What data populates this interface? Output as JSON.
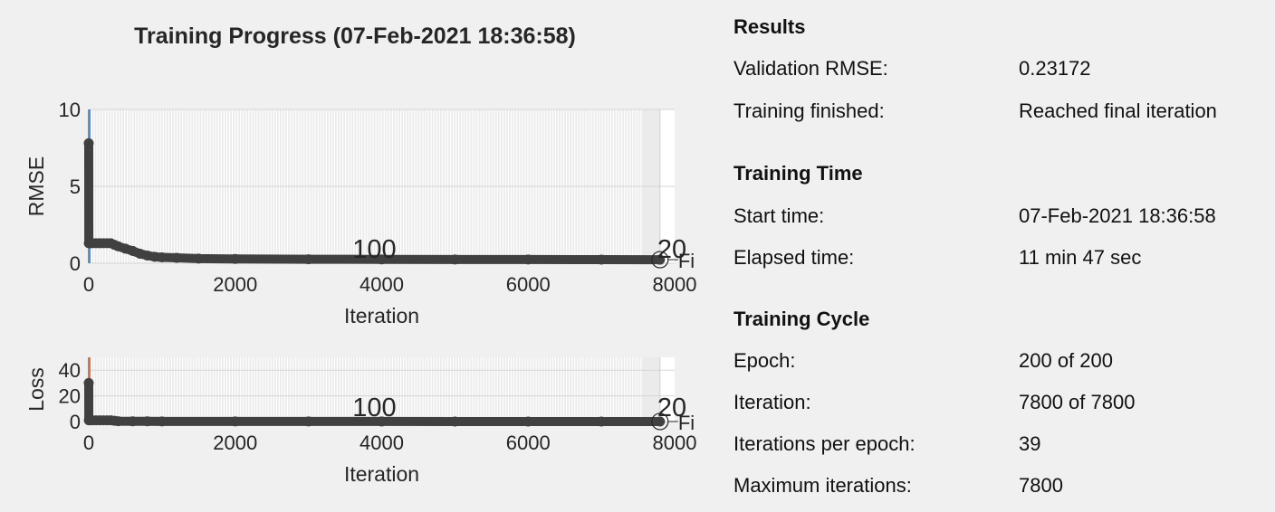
{
  "chart_data": [
    {
      "type": "line",
      "title": "Training Progress (07-Feb-2021 18:36:58)",
      "xlabel": "Iteration",
      "ylabel": "RMSE",
      "xlim": [
        0,
        8000
      ],
      "ylim": [
        0,
        10
      ],
      "xticks": [
        0,
        2000,
        4000,
        6000,
        8000
      ],
      "yticks": [
        0,
        5,
        10
      ],
      "grid": true,
      "epoch_labels": [
        {
          "x": 3900,
          "text": "100"
        },
        {
          "x": 7800,
          "text": "20"
        }
      ],
      "final_marker": {
        "x": 7800,
        "y": 0.23172,
        "label": "Fi"
      },
      "series": [
        {
          "x": [
            0,
            1,
            20,
            50,
            100,
            150,
            200,
            250,
            300,
            350,
            400,
            500,
            600,
            700,
            800,
            900,
            1000,
            1200,
            1500,
            2000,
            3000,
            4000,
            5000,
            6000,
            7000,
            7800
          ],
          "y": [
            7.8,
            1.3,
            1.3,
            1.3,
            1.3,
            1.3,
            1.3,
            1.3,
            1.3,
            1.2,
            1.1,
            0.95,
            0.8,
            0.62,
            0.5,
            0.42,
            0.38,
            0.35,
            0.3,
            0.28,
            0.26,
            0.25,
            0.24,
            0.24,
            0.235,
            0.23
          ]
        }
      ]
    },
    {
      "type": "line",
      "xlabel": "Iteration",
      "ylabel": "Loss",
      "xlim": [
        0,
        8000
      ],
      "ylim": [
        0,
        50
      ],
      "xticks": [
        0,
        2000,
        4000,
        6000,
        8000
      ],
      "yticks": [
        0,
        20,
        40
      ],
      "grid": true,
      "epoch_labels": [
        {
          "x": 3900,
          "text": "100"
        },
        {
          "x": 7800,
          "text": "20"
        }
      ],
      "final_marker": {
        "x": 7800,
        "y": 0.03,
        "label": "Fi"
      },
      "series": [
        {
          "x": [
            0,
            1,
            20,
            50,
            100,
            150,
            200,
            250,
            300,
            350,
            400,
            600,
            800,
            1000,
            2000,
            3000,
            4000,
            5000,
            6000,
            7000,
            7800
          ],
          "y": [
            30,
            1.0,
            1.0,
            1.0,
            1.0,
            1.0,
            1.0,
            1.0,
            1.0,
            0.6,
            0.3,
            0.2,
            0.15,
            0.12,
            0.08,
            0.06,
            0.05,
            0.04,
            0.04,
            0.03,
            0.03
          ]
        }
      ]
    }
  ],
  "results": {
    "title": "Results",
    "rows": [
      {
        "label": "Validation RMSE:",
        "value": "0.23172"
      },
      {
        "label": "Training finished:",
        "value": "Reached final iteration"
      }
    ]
  },
  "training_time": {
    "title": "Training Time",
    "rows": [
      {
        "label": "Start time:",
        "value": "07-Feb-2021 18:36:58"
      },
      {
        "label": "Elapsed time:",
        "value": "11 min 47 sec"
      }
    ]
  },
  "training_cycle": {
    "title": "Training Cycle",
    "rows": [
      {
        "label": "Epoch:",
        "value": "200 of 200"
      },
      {
        "label": "Iteration:",
        "value": "7800 of 7800"
      },
      {
        "label": "Iterations per epoch:",
        "value": "39"
      },
      {
        "label": "Maximum iterations:",
        "value": "7800"
      }
    ]
  }
}
